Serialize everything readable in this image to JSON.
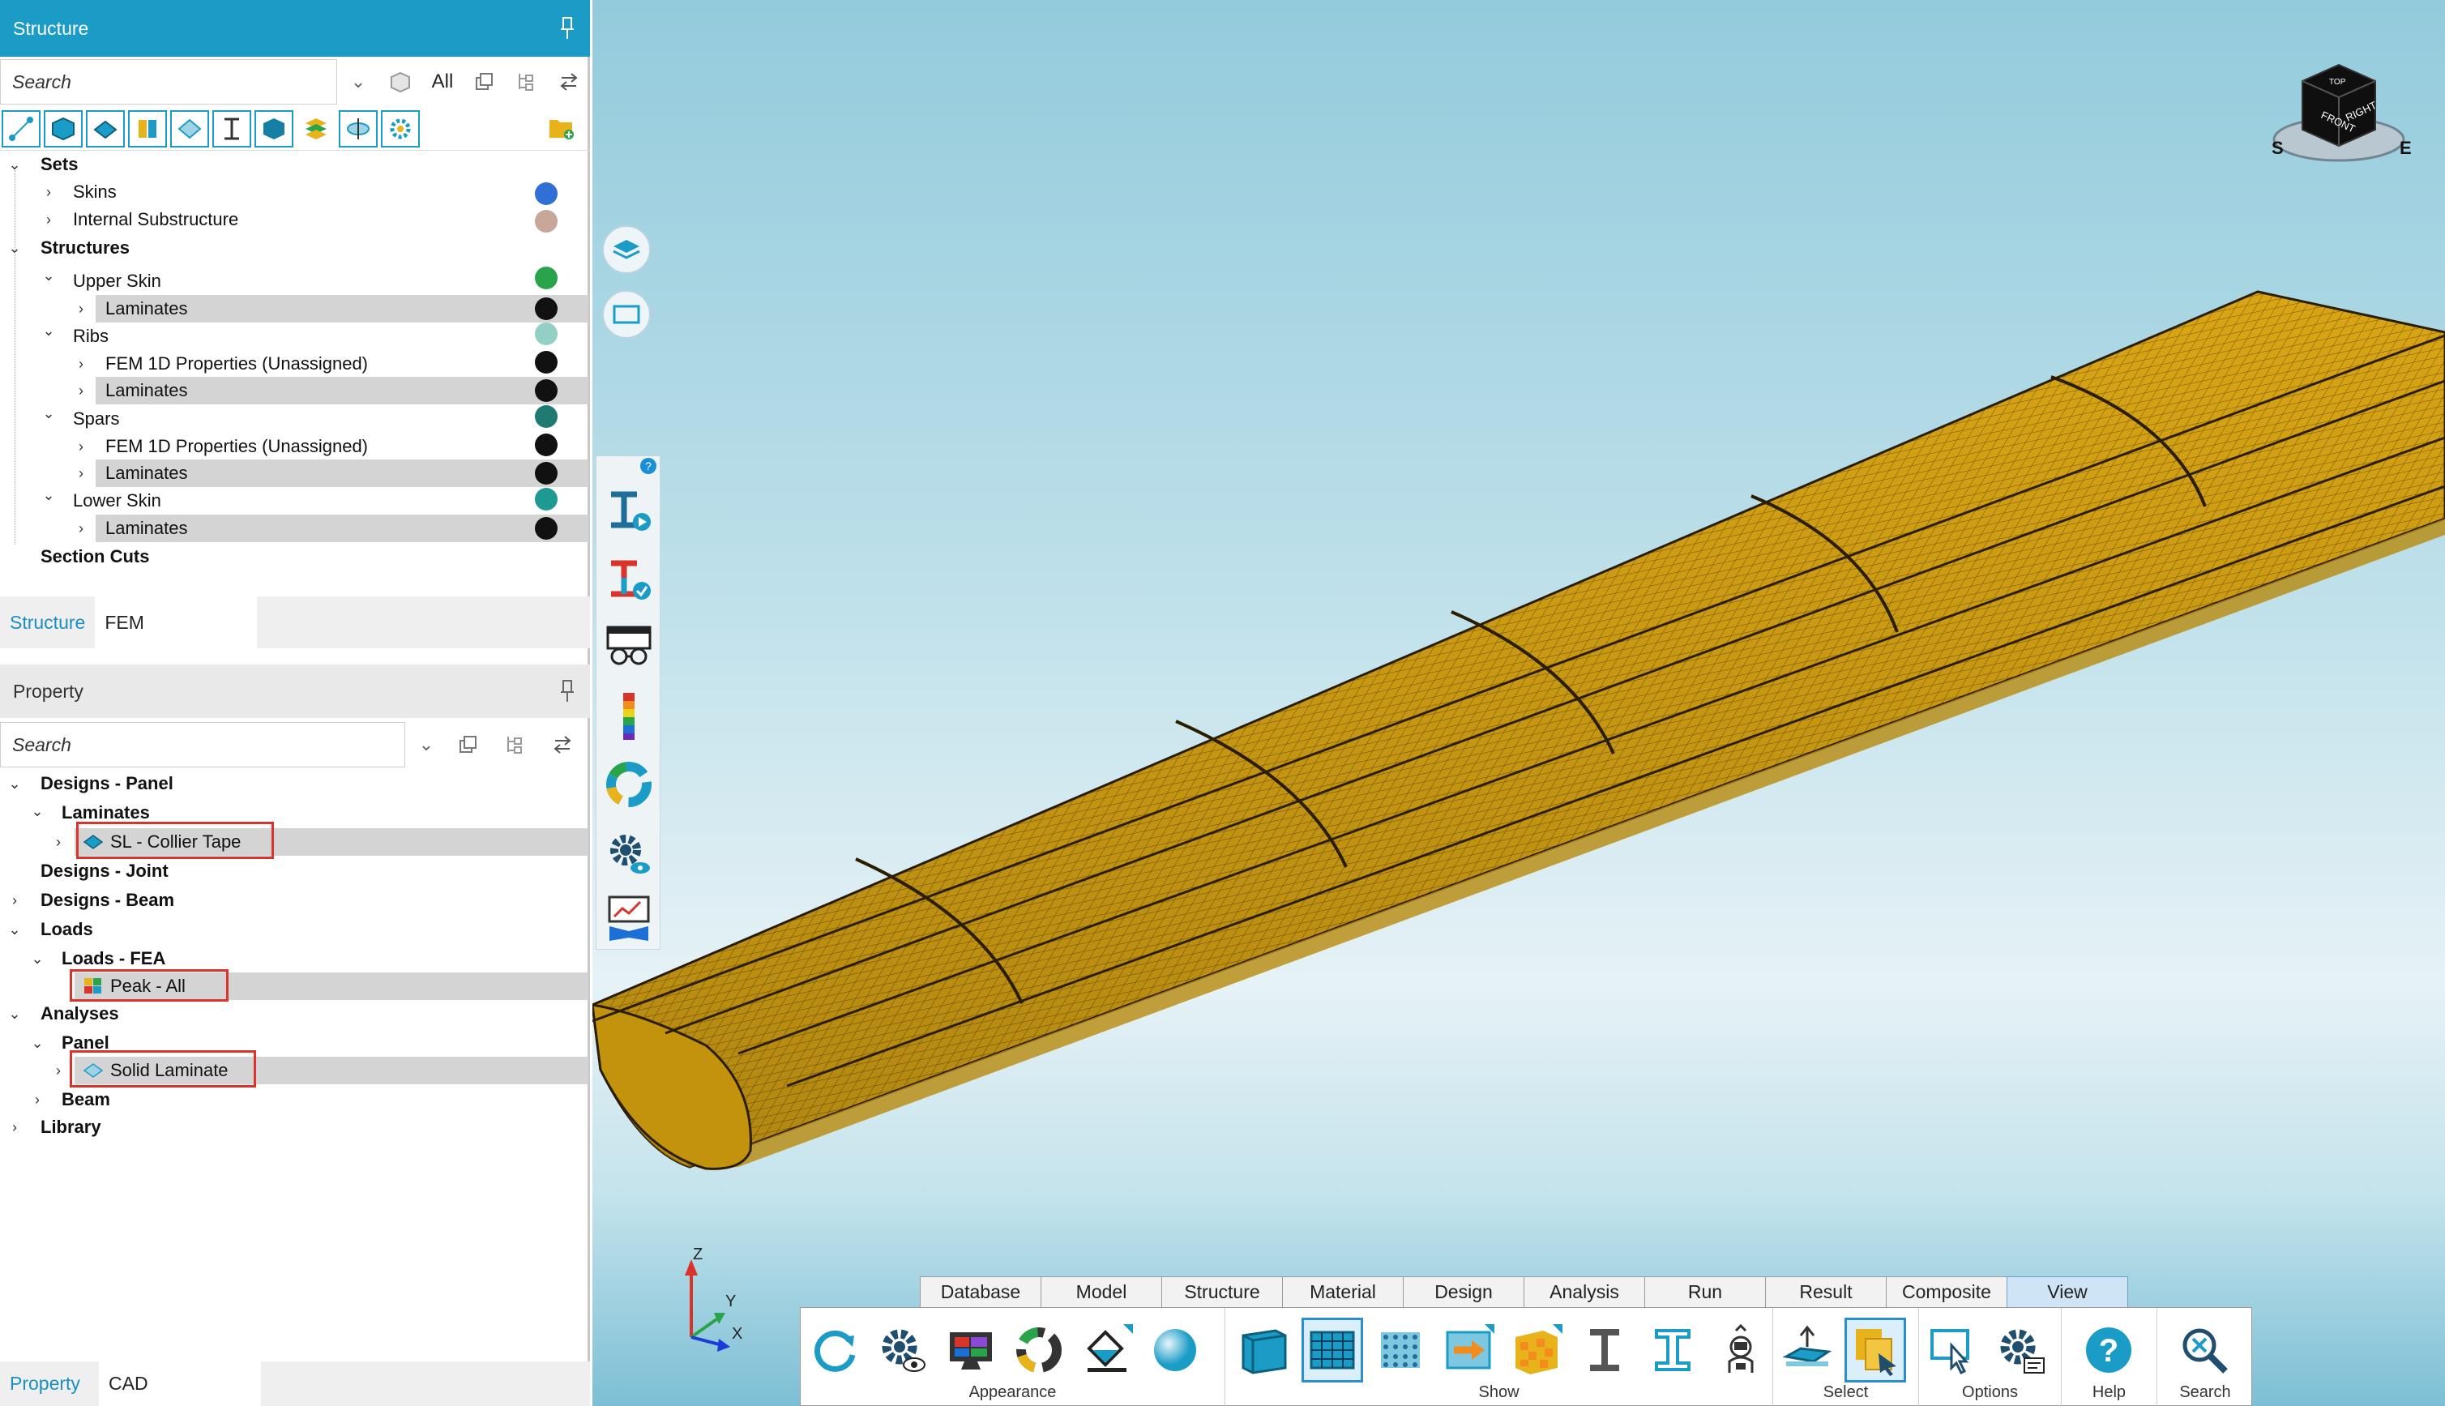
{
  "structure_panel": {
    "title": "Structure",
    "search_placeholder": "Search",
    "filter_all": "All",
    "tree": {
      "sets": "Sets",
      "skins": "Skins",
      "internal_substructure": "Internal Substructure",
      "structures": "Structures",
      "upper_skin": "Upper Skin",
      "laminates_1": "Laminates",
      "ribs": "Ribs",
      "fem_1d_1": "FEM 1D Properties (Unassigned)",
      "laminates_2": "Laminates",
      "spars": "Spars",
      "fem_1d_2": "FEM 1D Properties (Unassigned)",
      "laminates_3": "Laminates",
      "lower_skin": "Lower Skin",
      "laminates_4": "Laminates",
      "section_cuts": "Section Cuts"
    },
    "tabs": {
      "structure": "Structure",
      "fem": "FEM"
    }
  },
  "property_panel": {
    "title": "Property",
    "search_placeholder": "Search",
    "tree": {
      "designs_panel": "Designs - Panel",
      "laminates": "Laminates",
      "sl_collier_tape": "SL - Collier Tape",
      "designs_joint": "Designs - Joint",
      "designs_beam": "Designs - Beam",
      "loads": "Loads",
      "loads_fea": "Loads - FEA",
      "peak_all": "Peak - All",
      "analyses": "Analyses",
      "panel": "Panel",
      "solid_laminate": "Solid Laminate",
      "beam": "Beam",
      "library": "Library"
    },
    "tabs": {
      "property": "Property",
      "cad": "CAD"
    }
  },
  "colors": {
    "accent": "#1b9cc6",
    "skins": "#2f6fd6",
    "internal_substructure": "#c9a69a",
    "upper_skin": "#2aa44a",
    "laminate": "#111111",
    "ribs": "#93cfc4",
    "spars": "#1f7a72",
    "lower_skin": "#1f9a92",
    "highlight_box": "#d9342b",
    "wing_mesh": "#d9a514"
  },
  "nav_cube": {
    "front": "FRONT",
    "right": "RIGHT",
    "top": "TOP"
  },
  "axes": {
    "x": "X",
    "y": "Y",
    "z": "Z"
  },
  "ribbon": {
    "tabs": [
      "Database",
      "Model",
      "Structure",
      "Material",
      "Design",
      "Analysis",
      "Run",
      "Result",
      "Composite",
      "View"
    ],
    "active_tab": "View",
    "groups": {
      "appearance": "Appearance",
      "show": "Show",
      "select": "Select",
      "options": "Options",
      "help": "Help",
      "search": "Search"
    }
  }
}
